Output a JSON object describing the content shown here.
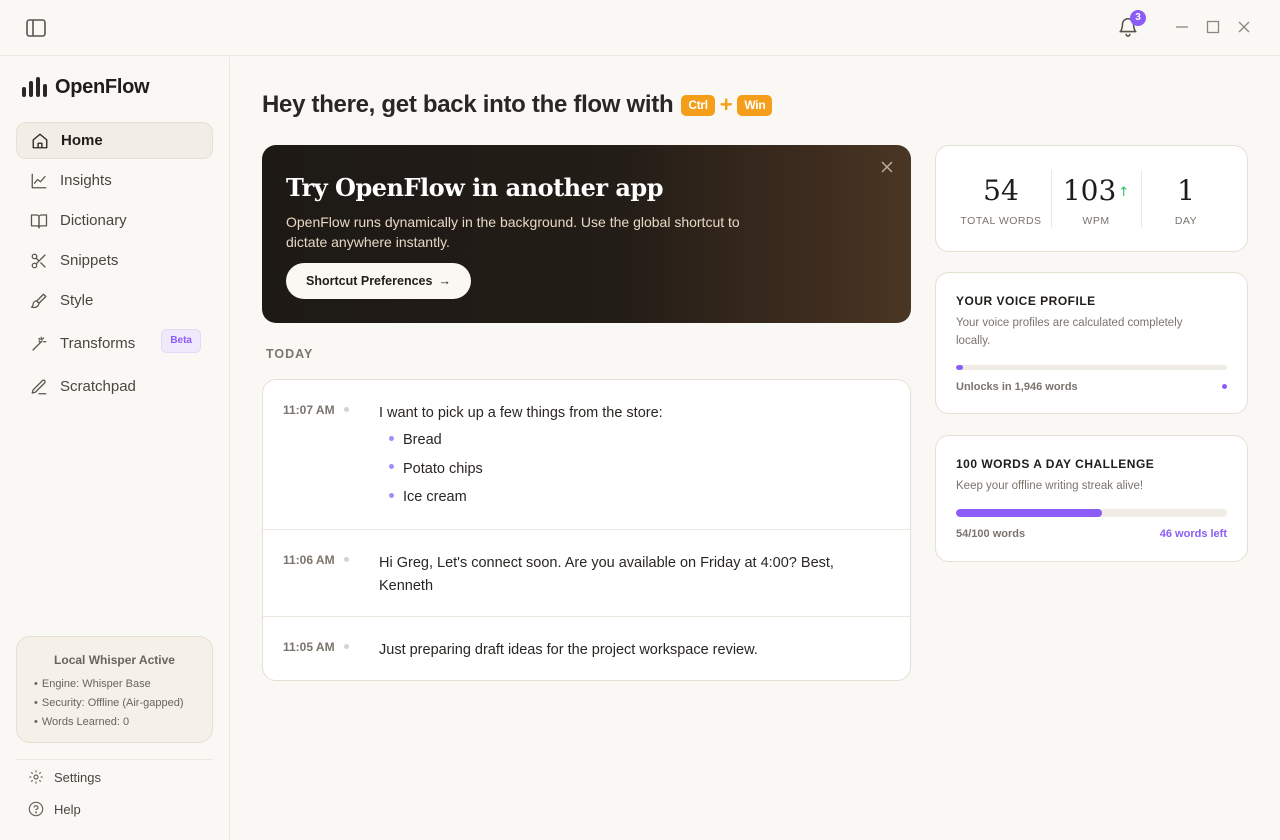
{
  "titlebar": {
    "notification_count": "3"
  },
  "app": {
    "name": "OpenFlow"
  },
  "sidebar": {
    "items": [
      {
        "label": "Home",
        "icon": "home-icon",
        "active": true
      },
      {
        "label": "Insights",
        "icon": "chart-line-icon"
      },
      {
        "label": "Dictionary",
        "icon": "book-icon"
      },
      {
        "label": "Snippets",
        "icon": "scissors-icon"
      },
      {
        "label": "Style",
        "icon": "paintbrush-icon"
      },
      {
        "label": "Transforms",
        "icon": "magic-wand-icon",
        "badge": "Beta"
      },
      {
        "label": "Scratchpad",
        "icon": "pencil-icon"
      }
    ],
    "status": {
      "title": "Local Whisper Active",
      "lines": [
        "Engine: Whisper Base",
        "Security: Offline (Air-gapped)",
        "Words Learned: 0"
      ]
    },
    "footer": {
      "settings": "Settings",
      "help": "Help"
    }
  },
  "main": {
    "greeting": "Hey there, get back into the flow with",
    "shortcut_keys": [
      "Ctrl",
      "Win"
    ],
    "shortcut_joiner": "+",
    "promo": {
      "title": "Try OpenFlow in another app",
      "text": "OpenFlow runs dynamically in the background. Use the global shortcut to dictate anywhere instantly.",
      "button_label": "Shortcut Preferences",
      "button_arrow": "→"
    },
    "section_label": "TODAY",
    "entries": [
      {
        "time": "11:07 AM",
        "text": "I want to pick up a few things from the store:",
        "items": [
          "Bread",
          "Potato chips",
          "Ice cream"
        ]
      },
      {
        "time": "11:06 AM",
        "text": "Hi Greg, Let's connect soon. Are you available on Friday at 4:00? Best, Kenneth"
      },
      {
        "time": "11:05 AM",
        "text": "Just preparing draft ideas for the project workspace review."
      }
    ]
  },
  "stats": {
    "total_words": {
      "value": "54",
      "label": "TOTAL WORDS"
    },
    "wpm": {
      "value": "103",
      "label": "WPM",
      "trend": "↑"
    },
    "day": {
      "value": "1",
      "label": "DAY"
    }
  },
  "voice_profile": {
    "title": "YOUR VOICE PROFILE",
    "subtitle": "Your voice profiles are calculated completely locally.",
    "progress_fraction": 0.027,
    "unlock_text": "Unlocks in 1,946 words"
  },
  "challenge": {
    "title": "100 WORDS A DAY CHALLENGE",
    "subtitle": "Keep your offline writing streak alive!",
    "progress_fraction": 0.54,
    "progress_text": "54/100 words",
    "remaining_text": "46 words left"
  },
  "colors": {
    "accent": "#8b5cf6",
    "shortcut": "#f59e1b",
    "trend_up": "#22c55e"
  }
}
